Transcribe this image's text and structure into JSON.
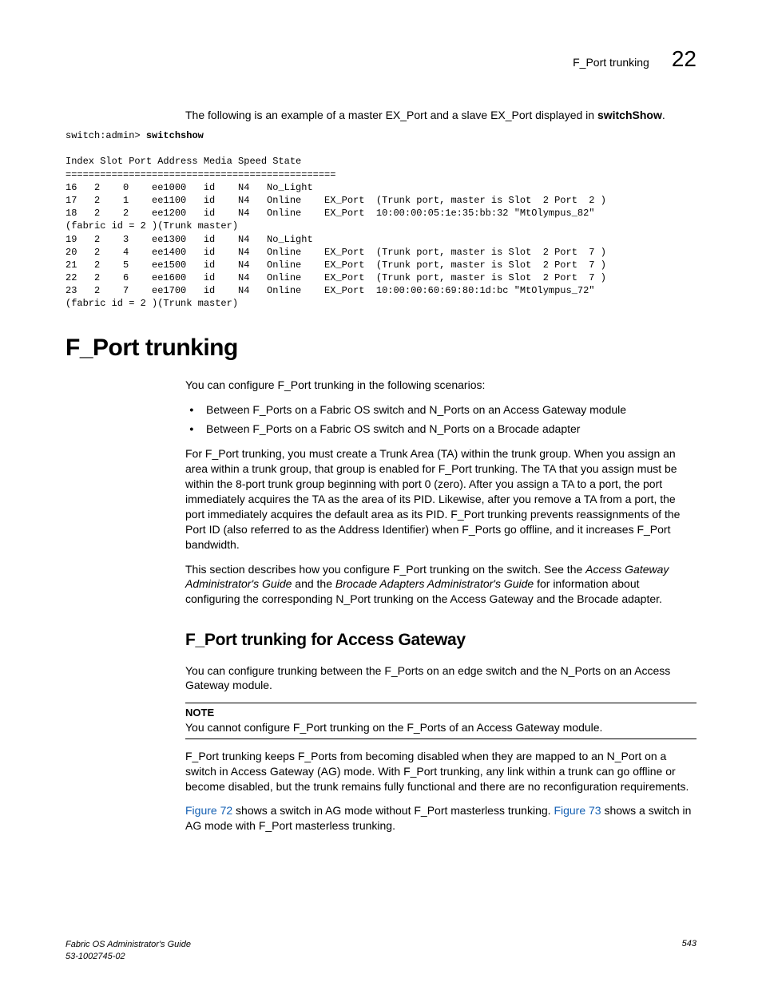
{
  "header": {
    "title": "F_Port trunking",
    "chapter_number": "22"
  },
  "intro": {
    "text_before_cmd": "The following is an example of a master EX_Port and a slave EX_Port displayed in ",
    "cmd": "switchShow",
    "text_after_cmd": "."
  },
  "terminal": {
    "prompt": "switch:admin> ",
    "command": "switchshow",
    "body": "Index Slot Port Address Media Speed State\n===============================================\n16   2    0    ee1000   id    N4   No_Light  \n17   2    1    ee1100   id    N4   Online    EX_Port  (Trunk port, master is Slot  2 Port  2 )\n18   2    2    ee1200   id    N4   Online    EX_Port  10:00:00:05:1e:35:bb:32 \"MtOlympus_82\" \n(fabric id = 2 )(Trunk master)  \n19   2    3    ee1300   id    N4   No_Light  \n20   2    4    ee1400   id    N4   Online    EX_Port  (Trunk port, master is Slot  2 Port  7 ) \n21   2    5    ee1500   id    N4   Online    EX_Port  (Trunk port, master is Slot  2 Port  7 ) \n22   2    6    ee1600   id    N4   Online    EX_Port  (Trunk port, master is Slot  2 Port  7 ) \n23   2    7    ee1700   id    N4   Online    EX_Port  10:00:00:60:69:80:1d:bc \"MtOlympus_72\" \n(fabric id = 2 )(Trunk master)"
  },
  "section": {
    "heading": "F_Port trunking",
    "p1": "You can configure F_Port trunking in the following scenarios:",
    "bullets": [
      "Between F_Ports on a Fabric OS switch and N_Ports on an Access Gateway module",
      "Between F_Ports on a Fabric OS switch and N_Ports on a Brocade adapter"
    ],
    "p2": "For F_Port trunking, you must create a Trunk Area (TA) within the trunk group. When you assign an area within a trunk group, that group is enabled for F_Port trunking. The TA that you assign must be within the 8-port trunk group beginning with port 0 (zero). After you assign a TA to a port, the port immediately acquires the TA as the area of its PID. Likewise, after you remove a TA from a port, the port immediately acquires the default area as its PID. F_Port trunking prevents reassignments of the Port ID (also referred to as the Address Identifier) when F_Ports go offline, and it increases F_Port bandwidth.",
    "p3a": "This section describes how you configure F_Port trunking on the switch. See the ",
    "p3_italic1": "Access Gateway Administrator's Guide",
    "p3b": " and the ",
    "p3_italic2": "Brocade Adapters Administrator's Guide",
    "p3c": " for information about configuring the corresponding N_Port trunking on the Access Gateway and the Brocade adapter."
  },
  "subsection": {
    "heading": "F_Port trunking for Access Gateway",
    "p1": "You can configure trunking between the F_Ports on an edge switch and the N_Ports on an Access Gateway module.",
    "note_label": "NOTE",
    "note_text": "You cannot configure F_Port trunking on the F_Ports of an Access Gateway module.",
    "p2": "F_Port trunking keeps F_Ports from becoming disabled when they are mapped to an N_Port on a switch in Access Gateway (AG) mode. With F_Port trunking, any link within a trunk can go offline or become disabled, but the trunk remains fully functional and there are no reconfiguration requirements.",
    "p3a": "",
    "xref1": "Figure 72",
    "p3b": " shows a switch in AG mode without F_Port masterless trunking. ",
    "xref2": "Figure 73",
    "p3c": " shows a switch in AG mode with F_Port masterless trunking."
  },
  "footer": {
    "book": "Fabric OS Administrator's Guide",
    "docnum": "53-1002745-02",
    "page": "543"
  }
}
